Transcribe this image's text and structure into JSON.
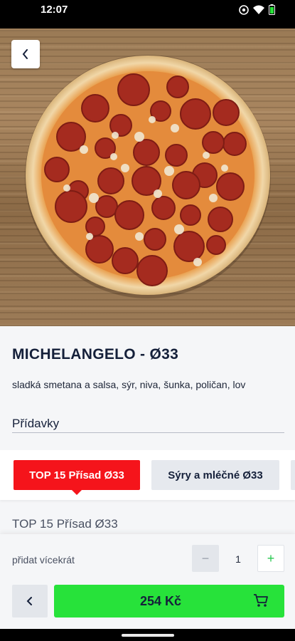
{
  "status_bar": {
    "time": "12:07"
  },
  "product": {
    "title": "MICHELANGELO - Ø33",
    "description": "sladká smetana a salsa, sýr, niva, šunka, poličan, lov",
    "addons_label": "Přídavky"
  },
  "tabs": [
    {
      "label": "TOP 15 Přísad Ø33",
      "active": true
    },
    {
      "label": "Sýry a mléčné Ø33",
      "active": false
    }
  ],
  "section_heading": "TOP 15 Přísad Ø33",
  "quantity": {
    "label": "přidat vícekrát",
    "minus": "−",
    "value": "1",
    "plus": "+"
  },
  "cart": {
    "price": "254 Kč"
  },
  "colors": {
    "accent_red": "#f5141b",
    "cta_green": "#27e23a",
    "text_dark": "#15203a"
  },
  "icons": [
    "chevron-left-icon",
    "cart-icon",
    "eye-icon",
    "wifi-icon",
    "battery-icon"
  ]
}
